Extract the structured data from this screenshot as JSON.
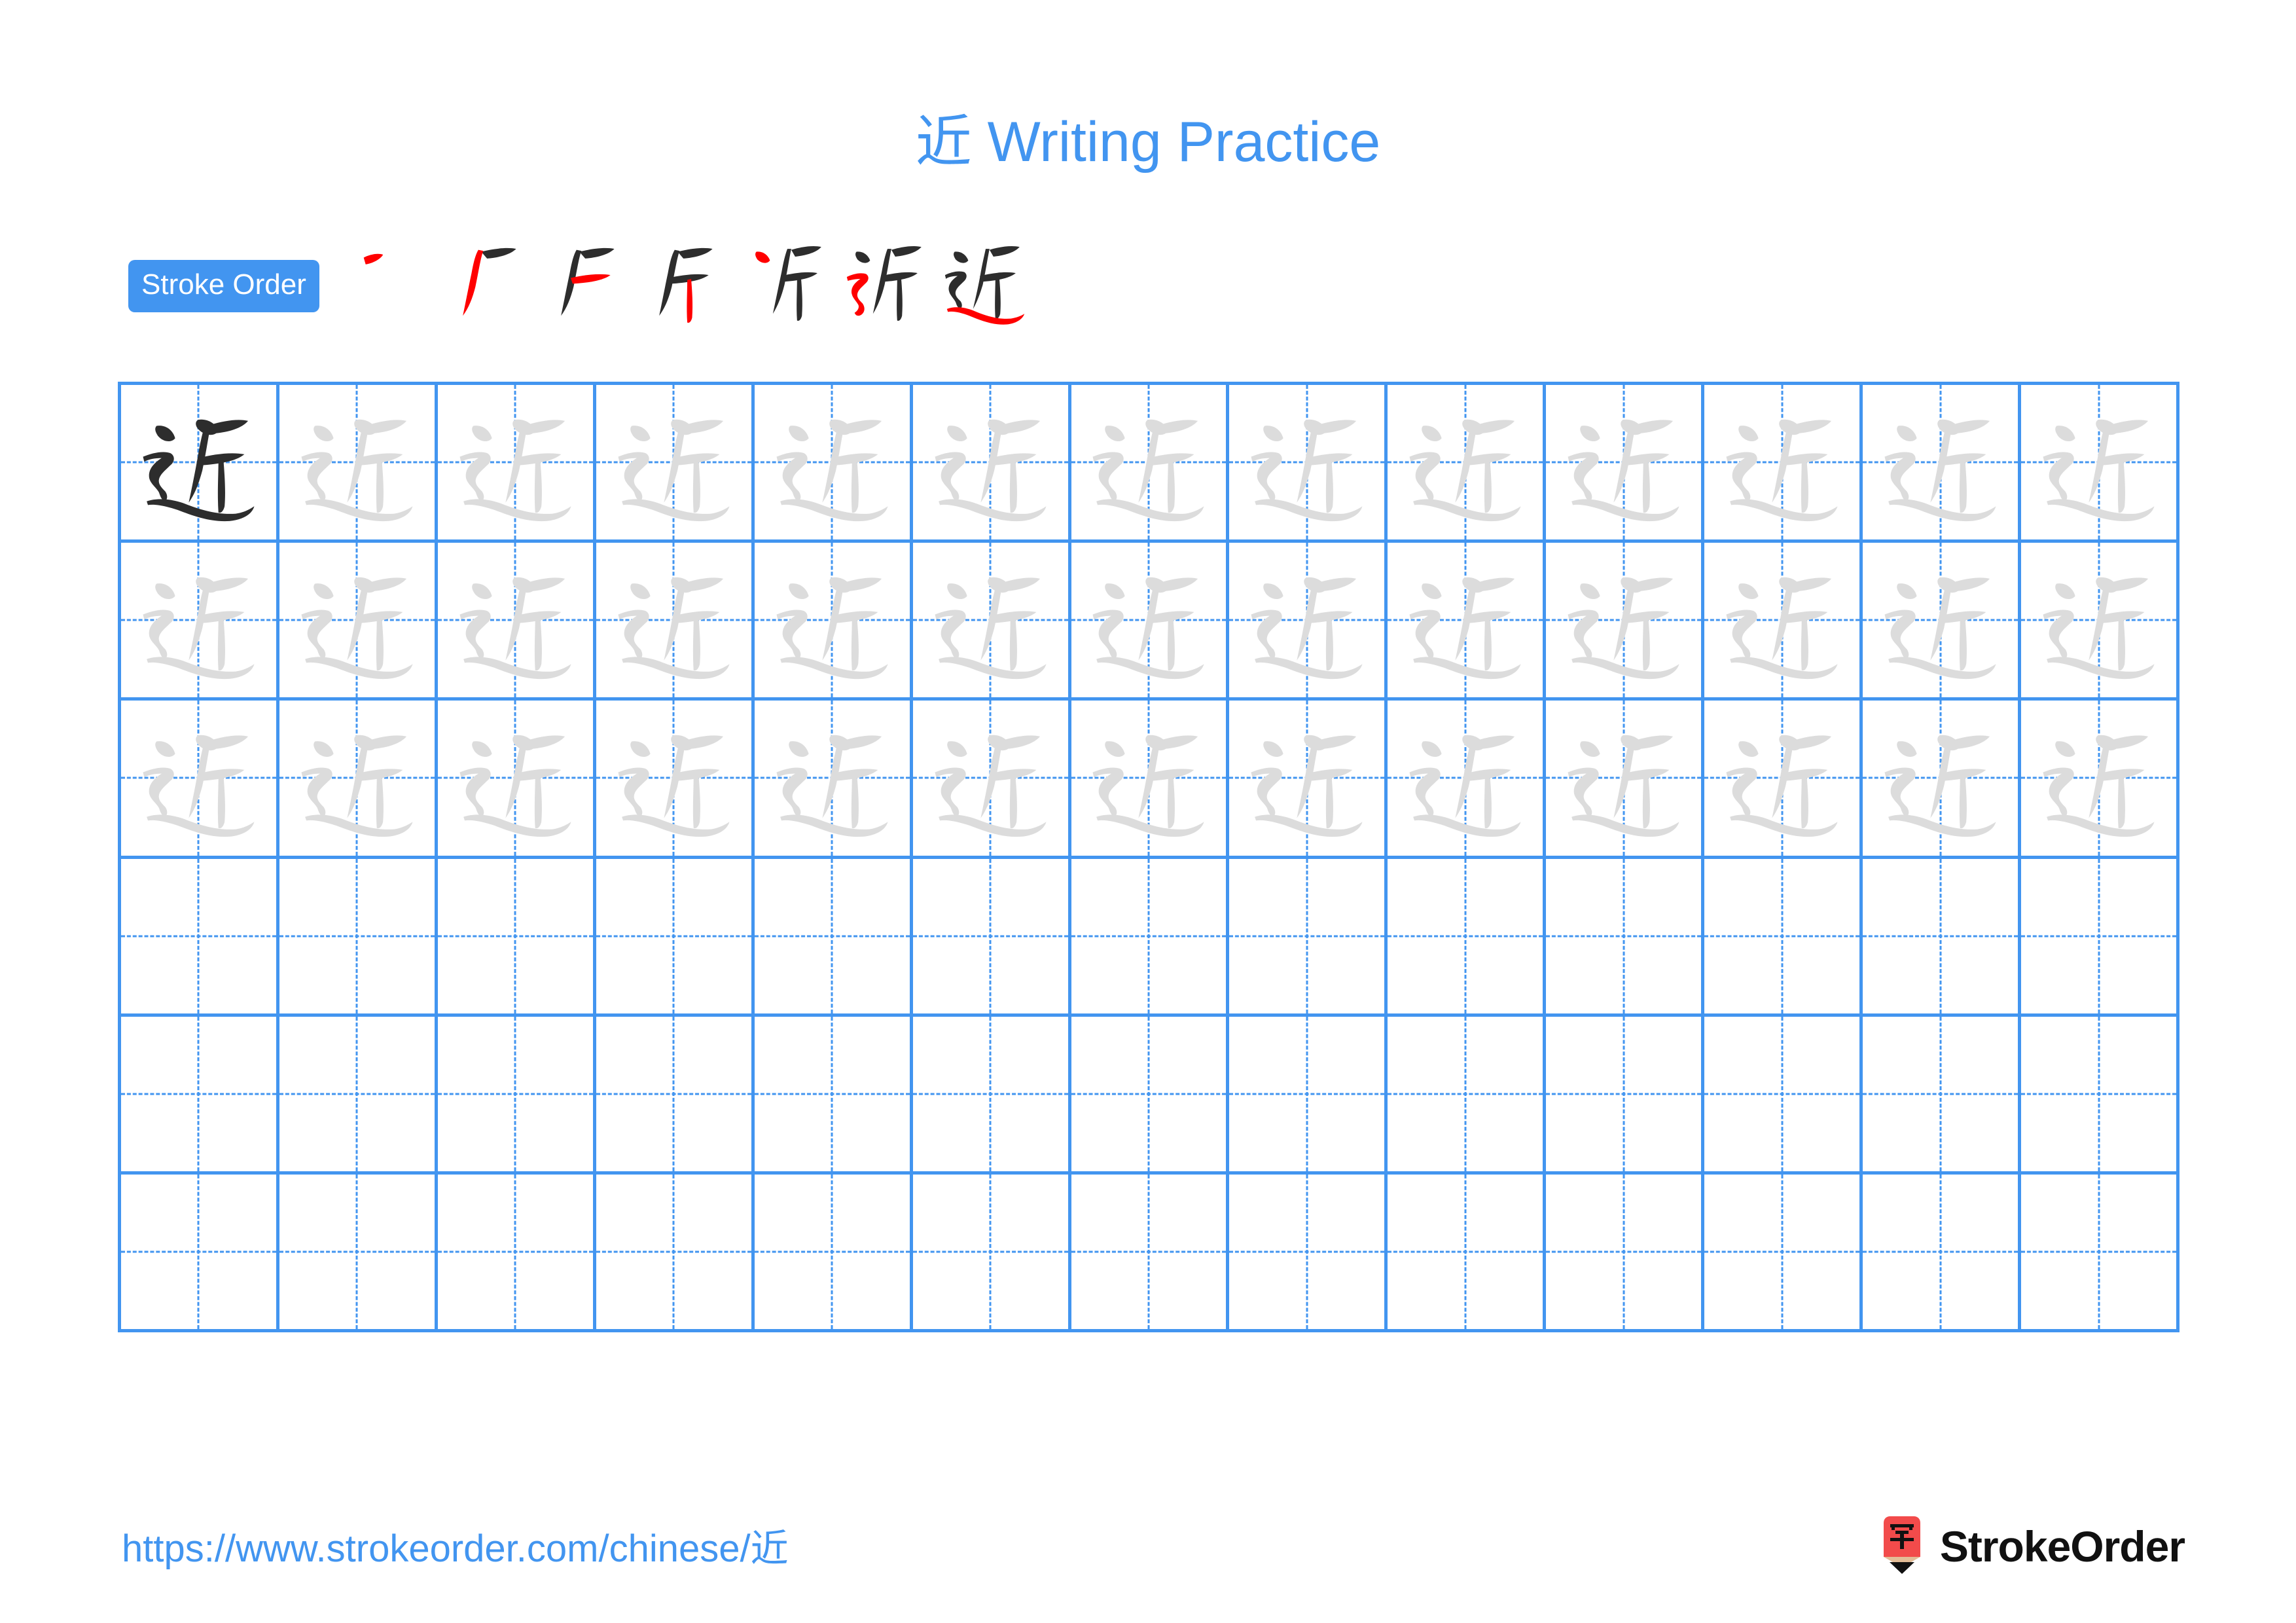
{
  "document": {
    "character": "近",
    "title_suffix": " Writing Practice",
    "title_full": "近 Writing Practice"
  },
  "stroke_order": {
    "badge_label": "Stroke Order",
    "stroke_count": 7,
    "steps": [
      {
        "index": 1,
        "new_stroke_name": "dian-dot",
        "cumulative": "丶"
      },
      {
        "index": 2,
        "new_stroke_name": "heng-pie",
        "cumulative": "丆"
      },
      {
        "index": 3,
        "new_stroke_name": "heng",
        "cumulative": "斤-partial-1"
      },
      {
        "index": 4,
        "new_stroke_name": "shu-vertical",
        "cumulative": "斤"
      },
      {
        "index": 5,
        "new_stroke_name": "dian-dot-left",
        "cumulative": "亓-partial"
      },
      {
        "index": 6,
        "new_stroke_name": "hengzhezhe-radical",
        "cumulative": "近-partial"
      },
      {
        "index": 7,
        "new_stroke_name": "pingna-sweep",
        "cumulative": "近"
      }
    ]
  },
  "grid": {
    "columns": 13,
    "rows": 6,
    "traced_rows": 3,
    "blank_rows": 3,
    "first_cell_style": "solid-dark",
    "trace_cell_style": "light-gray"
  },
  "footer": {
    "url_prefix": "https://www.strokeorder.com/chinese/",
    "url_character": "近",
    "url_full": "https://www.strokeorder.com/chinese/近",
    "brand_name": "StrokeOrder",
    "brand_mark_character": "字"
  },
  "colors": {
    "accent_blue": "#4295f0",
    "grid_line": "#4295f0",
    "ink_dark": "#2d2d2d",
    "ink_trace": "#dcdcdc",
    "stroke_new": "#ff0000",
    "brand_red": "#f24b4b",
    "brand_pencil_wood": "#e3bd97",
    "text_black": "#111111"
  }
}
